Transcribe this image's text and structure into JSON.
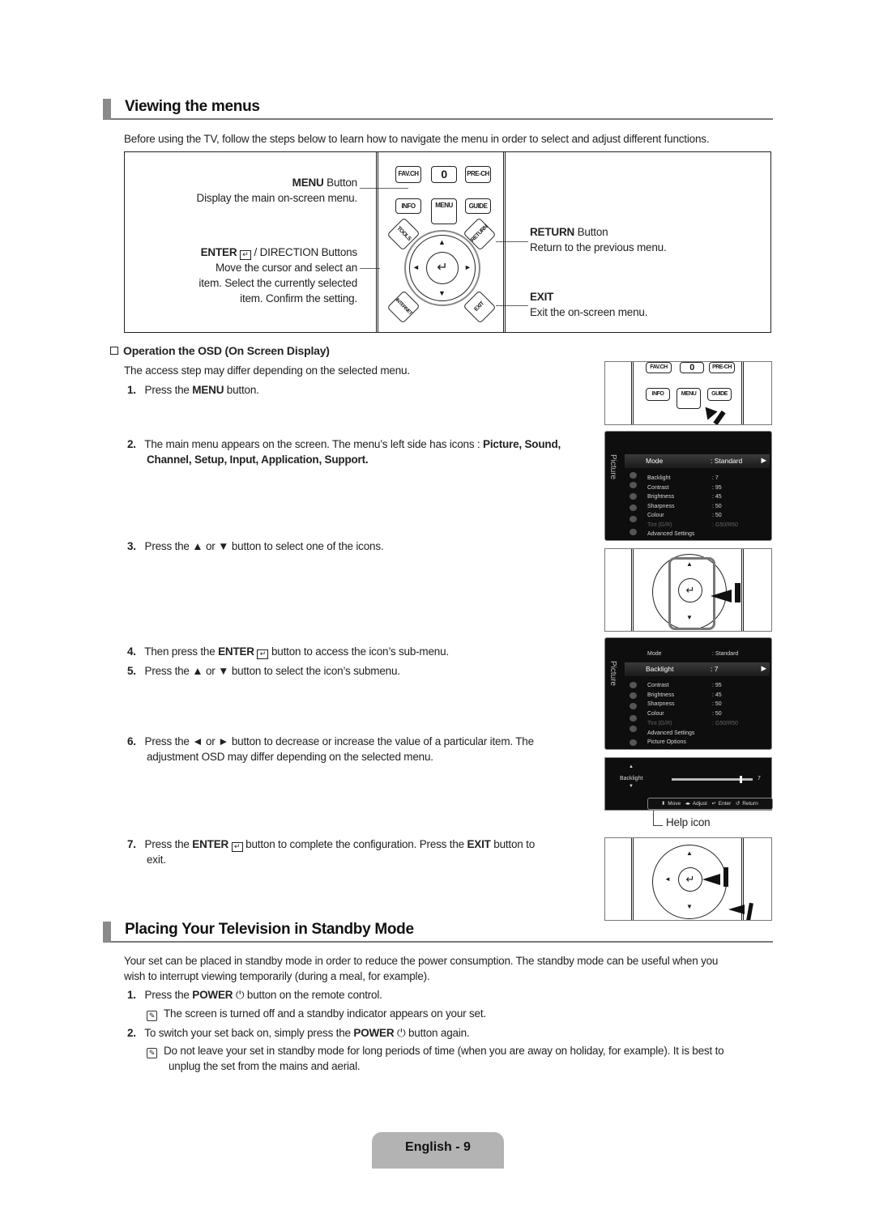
{
  "section1": {
    "title": "Viewing the menus",
    "intro": "Before using the TV, follow the steps below to learn how to navigate the menu in order to select and adjust different functions."
  },
  "remote_diagram": {
    "menu_label_bold": "MENU",
    "menu_label_rest": " Button",
    "menu_desc": "Display the main on-screen menu.",
    "enter_label_bold": "ENTER",
    "enter_label_rest": " / DIRECTION Buttons",
    "enter_desc_1": "Move the cursor and select an",
    "enter_desc_2": "item. Select the currently selected",
    "enter_desc_3": "item. Confirm the setting.",
    "return_label_bold": "RETURN",
    "return_label_rest": " Button",
    "return_desc": "Return to the previous menu.",
    "exit_label": "EXIT",
    "exit_desc": "Exit the on-screen menu.",
    "buttons": {
      "fav": "FAV.CH",
      "zero": "0",
      "pre": "PRE-CH",
      "info": "INFO",
      "menu": "MENU",
      "guide": "GUIDE",
      "tools": "TOOLS",
      "return": "RETURN",
      "internet": "INTERNET",
      "exit": "EXIT"
    }
  },
  "osd_section": {
    "heading": "Operation the OSD (On Screen Display)",
    "note": "The access step may differ depending on the selected menu.",
    "steps": [
      {
        "num": "1.",
        "pre": "Press the ",
        "bold": "MENU",
        "post": " button."
      },
      {
        "num": "2.",
        "pre": "The main menu appears on the screen. The menu’s left side has icons : ",
        "bold": "Picture, Sound,",
        "line2": "Channel, Setup, Input, Application, Support."
      },
      {
        "num": "3.",
        "text": "Press the ▲ or ▼ button to select one of the icons."
      },
      {
        "num": "4.",
        "pre": "Then press the ",
        "bold": "ENTER",
        "post": " button to access the icon’s sub-menu."
      },
      {
        "num": "5.",
        "text": "Press the ▲ or ▼ button to select the icon’s submenu."
      },
      {
        "num": "6.",
        "text": "Press the ◄ or ► button to decrease or increase the value of a particular item. The",
        "line2": "adjustment OSD may differ depending on the selected menu."
      },
      {
        "num": "7.",
        "pre": "Press the ",
        "bold": "ENTER",
        "mid": " button to complete the configuration. Press the ",
        "bold2": "EXIT",
        "post": " button to",
        "line2": "exit."
      }
    ]
  },
  "osd1": {
    "side_label": "Picture",
    "selected": {
      "key": "Mode",
      "value": ": Standard"
    },
    "rows": [
      {
        "key": "Backlight",
        "value": ": 7"
      },
      {
        "key": "Contrast",
        "value": ": 95"
      },
      {
        "key": "Brightness",
        "value": ": 45"
      },
      {
        "key": "Sharpness",
        "value": ": 50"
      },
      {
        "key": "Colour",
        "value": ": 50"
      },
      {
        "key": "Tint (G/R)",
        "value": ": G50/R50"
      },
      {
        "key": "Advanced Settings",
        "value": ""
      }
    ]
  },
  "osd2": {
    "side_label": "Picture",
    "top_row": {
      "key": "Mode",
      "value": ": Standard"
    },
    "selected": {
      "key": "Backlight",
      "value": ": 7"
    },
    "rows": [
      {
        "key": "Contrast",
        "value": ": 95"
      },
      {
        "key": "Brightness",
        "value": ": 45"
      },
      {
        "key": "Sharpness",
        "value": ": 50"
      },
      {
        "key": "Colour",
        "value": ": 50"
      },
      {
        "key": "Tint (G/R)",
        "value": ": G50/R50"
      },
      {
        "key": "Advanced Settings",
        "value": ""
      },
      {
        "key": "Picture Options",
        "value": ""
      }
    ]
  },
  "adjust_osd": {
    "label": "Backlight",
    "value": "7",
    "slider_fraction": 0.85,
    "help": {
      "move": "Move",
      "adjust": "Adjust",
      "enter": "Enter",
      "return": "Return"
    },
    "help_icon_label": "Help icon"
  },
  "section2": {
    "title": "Placing Your Television in Standby Mode",
    "intro_1": "Your set can be placed in standby mode in order to reduce the power consumption. The standby mode can be useful when you",
    "intro_2": "wish to interrupt viewing temporarily (during a meal, for example).",
    "step1": {
      "num": "1.",
      "pre": "Press the ",
      "bold": "POWER",
      "post": " button on the remote control."
    },
    "note1": "The screen is turned off and a standby indicator appears on your set.",
    "step2": {
      "num": "2.",
      "pre": "To switch your set back on, simply press the ",
      "bold": "POWER",
      "post": " button again."
    },
    "note2_1": "Do not leave your set in standby mode for long periods of time (when you are away on holiday, for example). It is best to",
    "note2_2": "unplug the set from the mains and aerial."
  },
  "footer": {
    "page_label": "English - 9"
  }
}
